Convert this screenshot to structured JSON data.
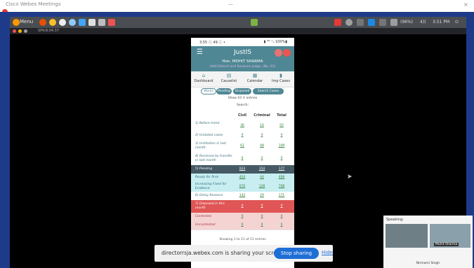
{
  "window": {
    "title": "Cisco Webex Meetings",
    "center": "—",
    "right": "×"
  },
  "panel": {
    "menu_label": "Menu",
    "status": [
      "(96%)",
      "4))",
      "3:51 PM"
    ]
  },
  "subbar": {
    "time": "SPK-8:04:37"
  },
  "phone": {
    "status_left": "3:55 ⓘ 49 ⓘ •",
    "status_right": "▮ ⁴ᴳ ⁺ᵢₗ 100%▮",
    "app_title": "JustIS",
    "user_name": "Hon. MOHIT SHARMA",
    "user_sub": "Addl District and Sessions Judge, (No. 01)",
    "nav": [
      {
        "icon": "⌂",
        "label": "Dashboard"
      },
      {
        "icon": "▤",
        "label": "Causelist"
      },
      {
        "icon": "▦",
        "label": "Calendar"
      },
      {
        "icon": "▮",
        "label": "Imp Cases"
      }
    ],
    "tabs": [
      "Works",
      "Pending",
      "Disposed",
      "Search Cases"
    ],
    "show": "Show  10  ↕  entries",
    "search": "Search:",
    "table": {
      "headers": [
        "",
        "Civil",
        "Criminal",
        "Total"
      ],
      "rows": [
        {
          "label": "1) Before trend",
          "civil": "36",
          "criminal": "14",
          "total": "50",
          "style": "plain"
        },
        {
          "label": "2) Undated cases",
          "civil": "0",
          "criminal": "0",
          "total": "0",
          "style": "plain"
        },
        {
          "label": "3) Institution in last month",
          "civil": "61",
          "criminal": "48",
          "total": "109",
          "style": "plain"
        },
        {
          "label": "4) Received by transfer in last month",
          "civil": "0",
          "criminal": "0",
          "total": "0",
          "style": "plain"
        },
        {
          "label": "5) Pending",
          "civil": "023",
          "criminal": "154",
          "total": "177",
          "style": "dark"
        },
        {
          "label": "Ready for final",
          "civil": "424",
          "criminal": "44",
          "total": "468",
          "style": "cyan"
        },
        {
          "label": "Increasing Fixed for Evidence",
          "civil": "670",
          "criminal": "128",
          "total": "798",
          "style": "cyan"
        },
        {
          "label": "6) Delay Reasons",
          "civil": "142",
          "criminal": "29",
          "total": "171",
          "style": "plain"
        },
        {
          "label": "7) Disposed in this month",
          "civil": "0",
          "criminal": "0",
          "total": "0",
          "style": "red"
        },
        {
          "label": "Contested",
          "civil": "0",
          "criminal": "0",
          "total": "0",
          "style": "pink"
        },
        {
          "label": "Uncontested",
          "civil": "0",
          "criminal": "0",
          "total": "0",
          "style": "pink"
        }
      ]
    },
    "showing": "Showing 1 to 11 of 11 entries"
  },
  "share": {
    "message": "directorrsja.webex.com is sharing your screen.",
    "stop_label": "Stop sharing",
    "hide_label": "Hide"
  },
  "video": {
    "speaking": "Speaking:",
    "tag": "Mohit Sharma",
    "name": "Nirmami Singh"
  },
  "colors": {
    "accent": "#4f8794",
    "frame": "#1e3b8a",
    "stop_button": "#1e6ed6"
  }
}
